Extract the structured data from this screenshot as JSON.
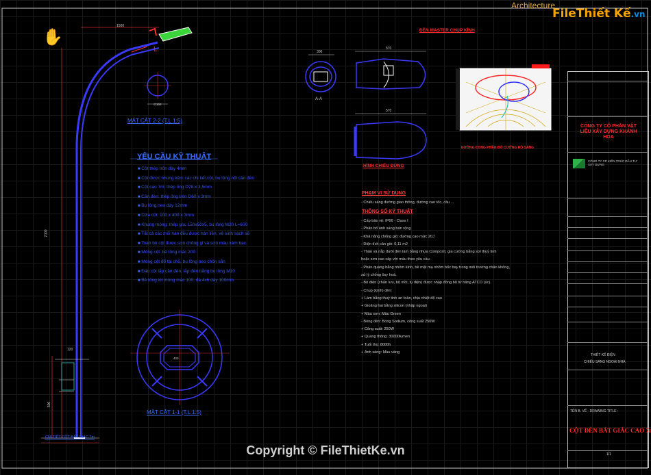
{
  "header": {
    "tab_label": "Architecture"
  },
  "watermark": {
    "logo_part1": "File",
    "logo_part2": "Thiết Kế",
    "logo_part3": ".vn",
    "copyright": "Copyright © FileThietKe.vn"
  },
  "drawing": {
    "section_22": "MẶT CẮT 2-2 (T.L 1:5)",
    "section_11": "MẶT CẮT 1-1 (T.L 1:5)",
    "base_detail": "CHI TIẾT CỘT BÁT GIÁC 7m",
    "lamp_title": "ĐÈN MASTER CHỤP KÍNH",
    "section_aa": "A-A",
    "plan_view": "HÌNH CHIẾU ĐỨNG",
    "photometric": "ĐƯỜNG CONG PHÂN BỐ CƯỜNG ĐỘ SÁNG",
    "dims": {
      "arm": "1500",
      "height": "7000",
      "base": "500",
      "lamp_w": "570",
      "lamp_h": "300",
      "sec": "∅160",
      "base_plate": "400",
      "t120": "120"
    }
  },
  "requirements": {
    "title": "YÊU CẦU KỸ THUẬT",
    "items": [
      "Cột thép tròn dày 4mm",
      "Cột được nhúng kẽm các chi tiết cột, bu lông nối cần đèn",
      "Cột cao 7m: thép ống D78 x 3,5mm",
      "Cần đèn: thép ống tròn D60 x 3mm",
      "Bu lông neo dày 12mm",
      "Cửa cột: 100 x 400 x 3mm",
      "Khung móng: thép góc L50x50x5, bu lông M20 L=600",
      "Tất cả các mối hàn đều được hàn liền, vệ sinh sạch sẽ",
      "Toàn bộ cột được sơn chống gỉ và sơn màu xám bạc",
      "Móng cột: bê tông mác 200",
      "Móng cột đổ tại chỗ, bu lông neo chôn sẵn",
      "Đầu cột lắp cần đèn, lắp đèn bằng bu lông M10",
      "Bê tông lót móng mác 100, đá 4x6 dày 100mm"
    ]
  },
  "scope": {
    "title": "PHẠM VI SỬ DỤNG",
    "line": "- Chiếu sáng đường giao thông, đường cao tốc, cầu ..."
  },
  "specs": {
    "title": "THÔNG SỐ KỸ THUẬT",
    "lines": [
      "- Cấp bảo vệ: IP66 - Class I",
      "- Phân bố ánh sáng bán rộng",
      "- Khả năng chống gió: đường cao mức 20J",
      "- Diện tích cản gió: 0,11 m2",
      "- Thân và nắp dưới đèn làm bằng nhựa Composit, gia cường bằng sợi thuỷ tinh",
      "  hoặc sơn cao cấp với màu theo yêu cầu.",
      "- Phản quang bằng nhôm kính, bề mặt mạ nhôm bốc bay trong môi trường chân không,",
      "  xử lý chống ôxy hoá.",
      "- Bộ điện (chấn lưu, bộ mồi, tụ điện) được nhập đồng bộ từ hãng ATCO (úc).",
      "- Chụp (kính) đèn:",
      "  + Làm bằng thuỷ tinh an toàn, chịu nhiệt độ cao",
      "  + Gioăng hai bằng silicon (nhập ngoại)",
      "  + Màu sơn: Màu Green",
      "- Bóng đèn: Bóng Sodium, công suất 250W",
      "     + Công suất: 250W",
      "     + Quang thông: 30000lumen",
      "     + Tuổi thọ: 8000h",
      "     + Ánh sáng: Màu vàng"
    ]
  },
  "title_block": {
    "company": "CÔNG TY CỔ PHẦN VẬT LIỆU XÂY DỰNG KHÁNH HÒA",
    "consultant": "CÔNG TY CP KIẾN TRÚC ĐẦU TƯ XÂY DỰNG",
    "project": "CHIẾU SÁNG NGOÀI NHÀ",
    "category": "THIẾT KẾ ĐIỆN",
    "drawing_title_label": "TÊN B. VẼ - DRAWING TITLE :",
    "drawing_title": "CỘT ĐÈN BÁT GIÁC CAO 7m",
    "sheet": "1/1"
  }
}
